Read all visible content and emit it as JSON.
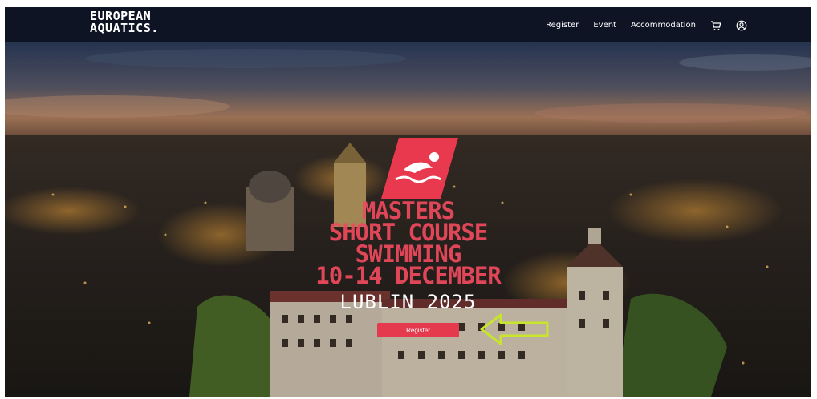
{
  "brand": {
    "line1": "EUROPEAN",
    "line2": "AQUATICS."
  },
  "nav": {
    "links": [
      "Register",
      "Event",
      "Accommodation"
    ],
    "cart_icon": "cart-icon",
    "user_icon": "user-account-icon"
  },
  "hero": {
    "title_lines": [
      "MASTERS",
      "SHORT COURSE",
      "SWIMMING",
      "10-14 DECEMBER"
    ],
    "location": "LUBLIN 2025",
    "cta_label": "Register",
    "arrow_color": "#c7e52a"
  },
  "colors": {
    "accent": "#e5394d",
    "nav_bg": "#0f1424",
    "title": "#ef4a5e"
  }
}
